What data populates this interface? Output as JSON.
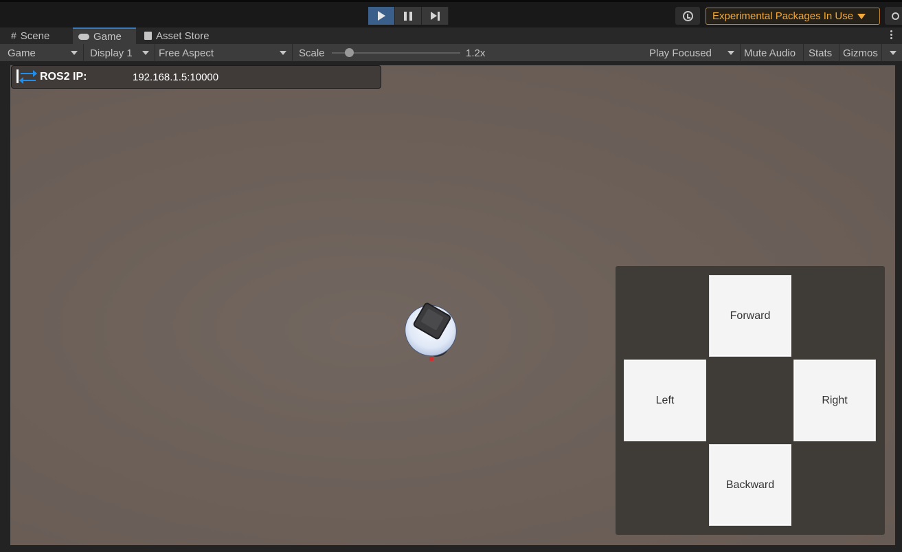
{
  "toolbar": {
    "experimental_label": "Experimental Packages In Use"
  },
  "tabs": [
    {
      "label": "Scene"
    },
    {
      "label": "Game"
    },
    {
      "label": "Asset Store"
    }
  ],
  "game_bar": {
    "mode": "Game",
    "display": "Display 1",
    "aspect": "Free Aspect",
    "scale_label": "Scale",
    "scale_value": "1.2x",
    "play_focused": "Play Focused",
    "mute_audio": "Mute Audio",
    "stats": "Stats",
    "gizmos": "Gizmos"
  },
  "ros": {
    "label": "ROS2 IP:",
    "value": "192.168.1.5:10000"
  },
  "controls": {
    "forward": "Forward",
    "left": "Left",
    "right": "Right",
    "backward": "Backward"
  },
  "colors": {
    "accent": "#3a79bb",
    "warning": "#f2a93b",
    "ros_arrow": "#1f8ef1",
    "ground": "#6c6059"
  }
}
